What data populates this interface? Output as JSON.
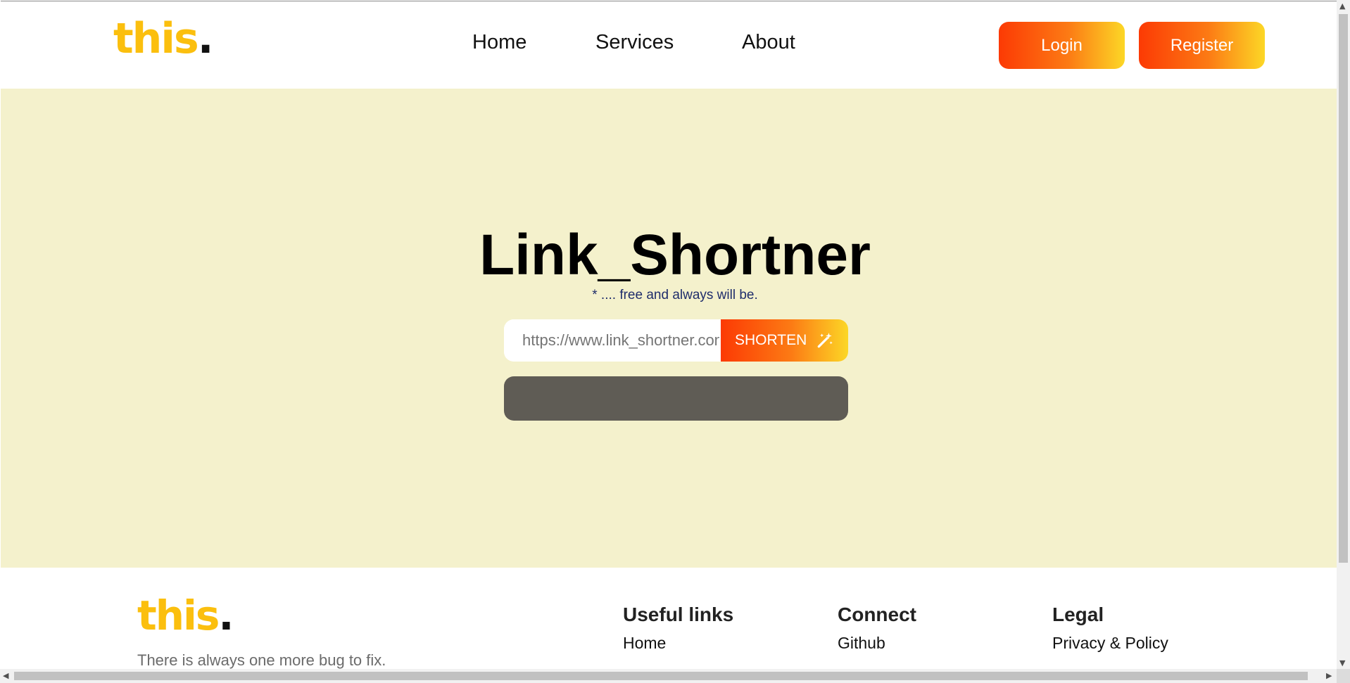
{
  "header": {
    "logo_text": "this",
    "logo_dot": ".",
    "nav": [
      "Home",
      "Services",
      "About"
    ],
    "login_label": "Login",
    "register_label": "Register"
  },
  "hero": {
    "title": "Link_Shortner",
    "subtitle": "* .... free and always will be.",
    "input_value": "",
    "input_placeholder": "https://www.link_shortner.com",
    "shorten_label": "SHORTEN",
    "shorten_icon": "magic-wand-icon"
  },
  "footer": {
    "logo_text": "this",
    "logo_dot": ".",
    "tagline": "There is always one more bug to fix.",
    "columns": [
      {
        "title": "Useful links",
        "link": "Home"
      },
      {
        "title": "Connect",
        "link": "Github"
      },
      {
        "title": "Legal",
        "link": "Privacy & Policy"
      }
    ]
  },
  "colors": {
    "brand_yellow": "#fbbf0e",
    "gradient_start": "#fc3a04",
    "gradient_end": "#fcd726",
    "hero_bg": "#f4f1cc",
    "result_box": "#5f5c55"
  }
}
